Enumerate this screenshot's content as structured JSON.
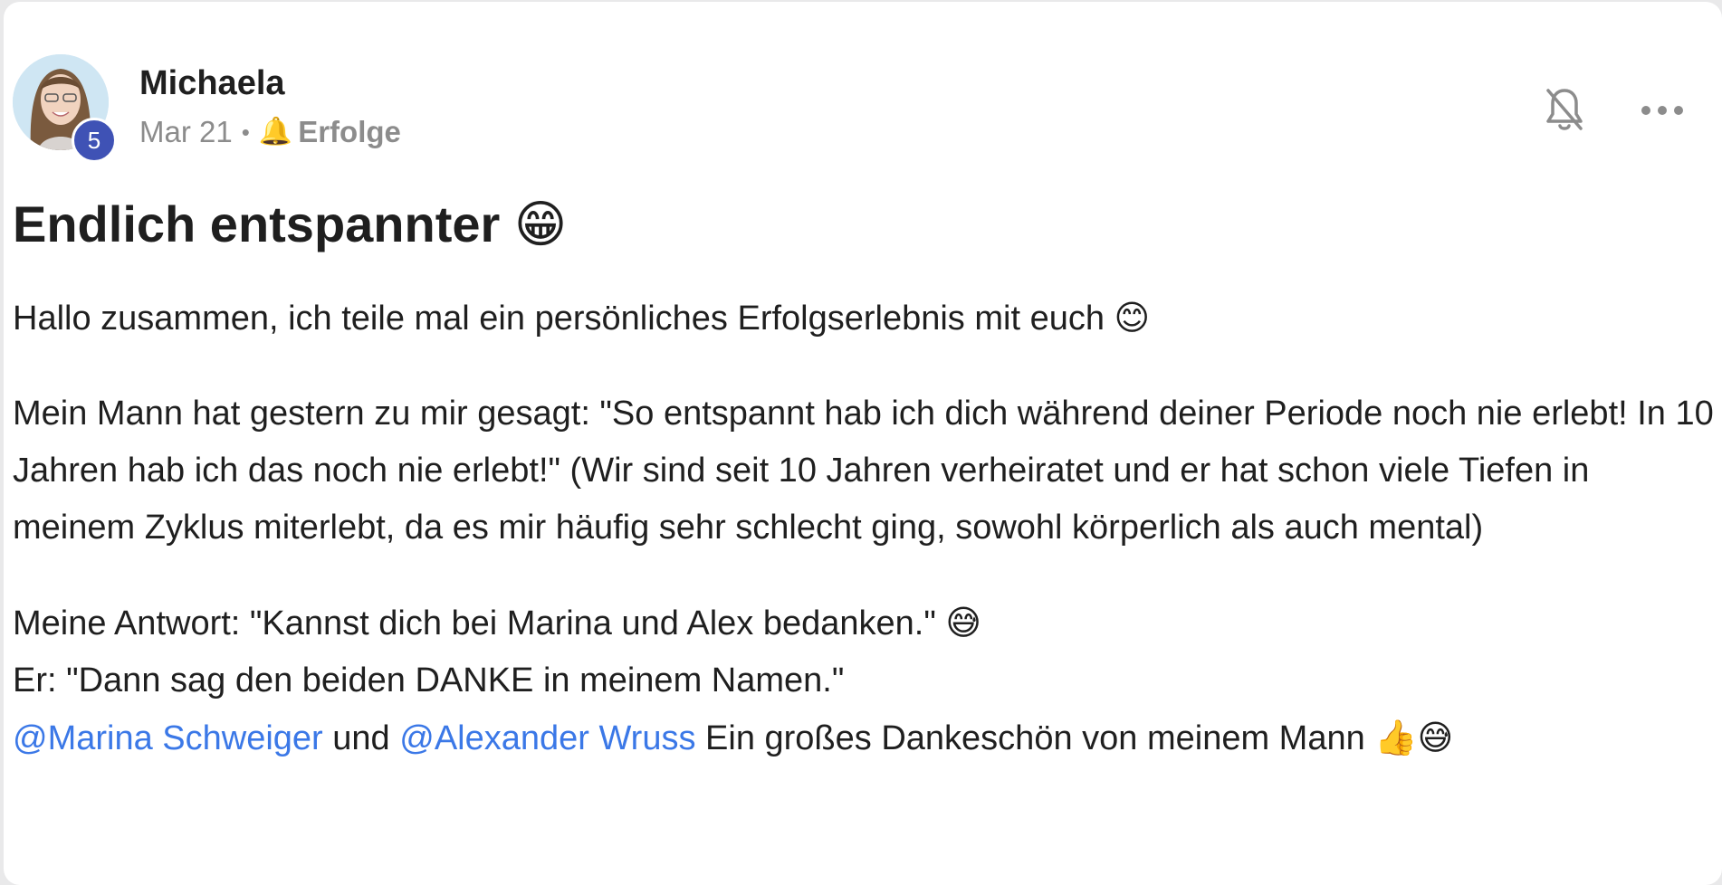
{
  "post": {
    "author": "Michaela",
    "level": "5",
    "date": "Mar 21",
    "separator": "•",
    "category_icon": "🔔",
    "category": "Erfolge",
    "title": "Endlich entspannter",
    "title_emoji": "😁",
    "paragraph1": "Hallo zusammen, ich teile mal ein persönliches Erfolgserlebnis mit euch",
    "paragraph1_emoji": "😊",
    "paragraph2": "Mein Mann hat gestern zu mir gesagt: \"So entspannt hab ich dich während deiner Periode noch nie erlebt! In 10 Jahren hab ich das noch nie erlebt!\" (Wir sind seit 10 Jahren verheiratet und er hat schon viele Tiefen in meinem Zyklus miterlebt, da es mir häufig sehr schlecht ging, sowohl körperlich als auch mental)",
    "line3a": "Meine Antwort: \"Kannst dich bei Marina und Alex bedanken.\"",
    "line3a_emoji": "😅",
    "line3b": "Er: \"Dann sag den beiden DANKE in meinem Namen.\"",
    "mention1": "@Marina Schweiger",
    "and_text": "und",
    "mention2": "@Alexander Wruss",
    "line3c": "Ein großes Dankeschön von meinem Mann",
    "line3c_emoji": "👍😅"
  },
  "icons": {
    "mute": "bell-off-icon",
    "more": "more-horizontal-icon"
  },
  "colors": {
    "badge": "#3f52b5",
    "mention": "#3b78e7",
    "text": "#1f1f1f",
    "muted": "#8c8c8c"
  }
}
